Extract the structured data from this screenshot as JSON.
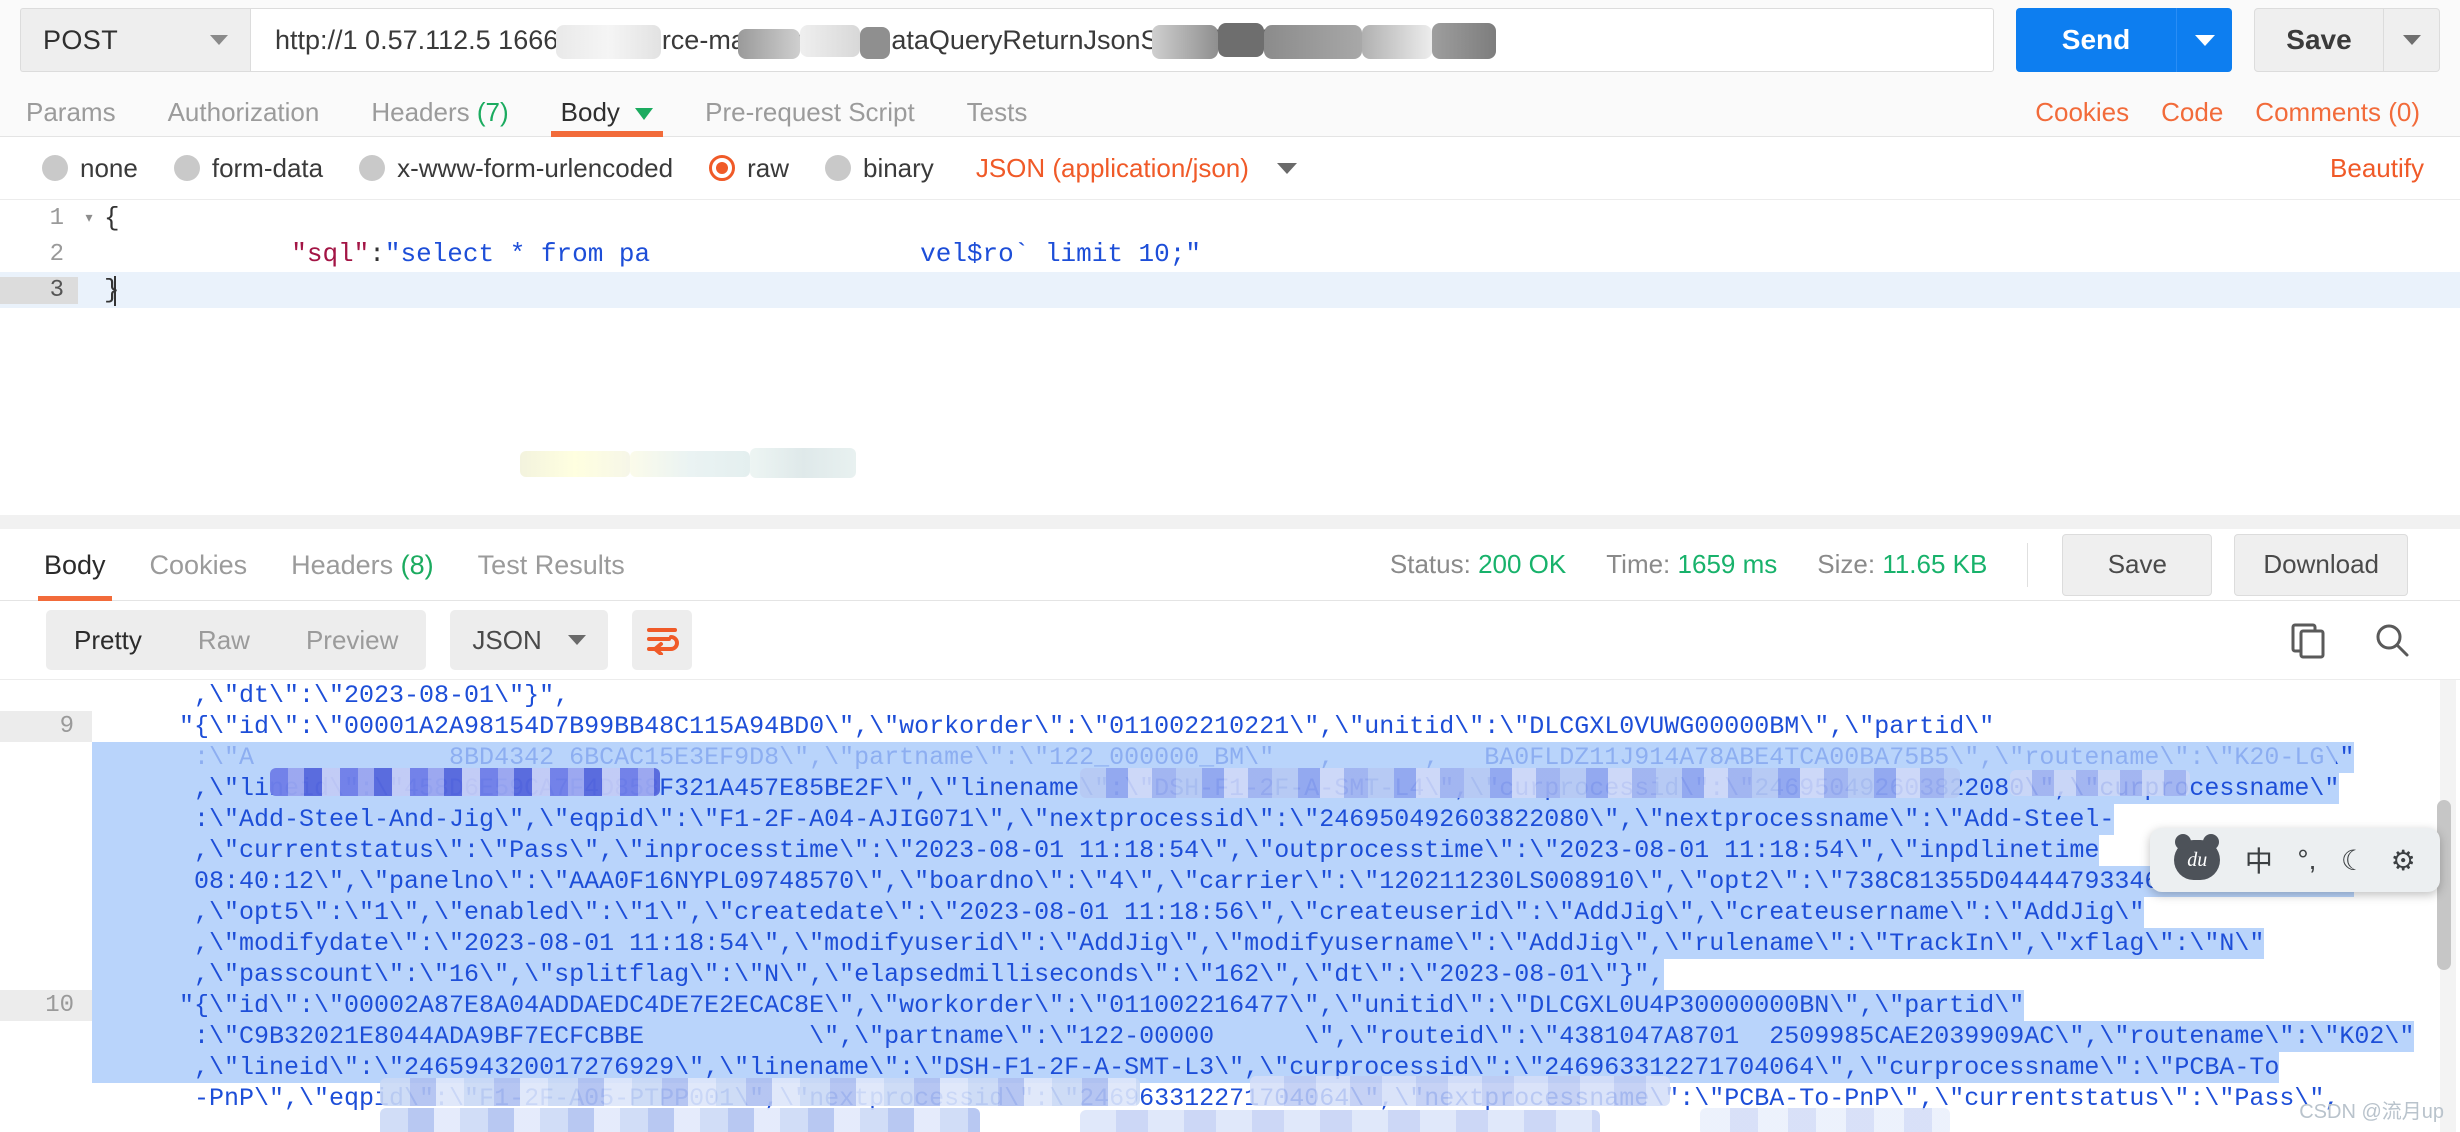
{
  "request": {
    "method": "POST",
    "url": "http://10.57.112.5:16666/add-resource-manager/smallDataQueryReturnJsonStrWithSqlDataJson",
    "url_visible": "http://1  0.57.112.5 16666/ad      source-manager/sm  lDataQueryReturnJsonStrWithSqlDataJson",
    "send_label": "Send",
    "save_label": "Save",
    "tabs": [
      {
        "label": "Params",
        "active": false,
        "count": ""
      },
      {
        "label": "Authorization",
        "active": false,
        "count": ""
      },
      {
        "label": "Headers",
        "active": false,
        "count": "(7)"
      },
      {
        "label": "Body",
        "active": true,
        "count": ""
      },
      {
        "label": "Pre-request Script",
        "active": false,
        "count": ""
      },
      {
        "label": "Tests",
        "active": false,
        "count": ""
      }
    ],
    "links": [
      "Cookies",
      "Code",
      "Comments (0)"
    ]
  },
  "body_types": [
    {
      "label": "none",
      "checked": false
    },
    {
      "label": "form-data",
      "checked": false
    },
    {
      "label": "x-www-form-urlencoded",
      "checked": false
    },
    {
      "label": "raw",
      "checked": true
    },
    {
      "label": "binary",
      "checked": false
    }
  ],
  "body_format": "JSON (application/json)",
  "beautify_label": "Beautify",
  "editor": {
    "lines": [
      {
        "num": "1",
        "fold": "▾",
        "text": "{",
        "current": false
      },
      {
        "num": "2",
        "fold": "",
        "text": "    \"sql\":\"select * from pa                       vel$ro` limit 10;\"",
        "current": false
      },
      {
        "num": "3",
        "fold": "",
        "text": "}",
        "current": true
      }
    ],
    "line2_key": "\"sql\"",
    "line2_sep": ":",
    "line2_val_start": "\"select * from pa",
    "line2_val_end": "vel$ro` limit 10;\""
  },
  "response": {
    "tabs": [
      {
        "label": "Body",
        "active": true,
        "count": ""
      },
      {
        "label": "Cookies",
        "active": false,
        "count": ""
      },
      {
        "label": "Headers",
        "active": false,
        "count": "(8)"
      },
      {
        "label": "Test Results",
        "active": false,
        "count": ""
      }
    ],
    "status_label": "Status:",
    "status_value": "200 OK",
    "time_label": "Time:",
    "time_value": "1659 ms",
    "size_label": "Size:",
    "size_value": "11.65 KB",
    "save_label": "Save",
    "download_label": "Download",
    "view_modes": [
      {
        "label": "Pretty",
        "active": true
      },
      {
        "label": "Raw",
        "active": false
      },
      {
        "label": "Preview",
        "active": false
      }
    ],
    "format": "JSON",
    "wrap_icon": "word-wrap-icon",
    "copy_icon": "copy-icon",
    "search_icon": "search-icon",
    "body_lines": [
      {
        "num": "",
        "sel": false,
        "text": "      ,\\\"dt\\\":\\\"2023-08-01\\\"}\","
      },
      {
        "num": "9",
        "sel": false,
        "text": "     \"{\\\"id\\\":\\\"00001A2A98154D7B99BB48C115A94BD0\\\",\\\"workorder\\\":\\\"011002210221\\\",\\\"unitid\\\":\\\"DLCGXL0VUWG00000BM\\\",\\\"partid\\\""
      },
      {
        "num": "",
        "sel": true,
        "text": "      :\\\"A             8BD4342 6BCAC15E3EF9D8\\\",\\\"partname\\\":\\\"122_000000_BM\\\"   ,      ,   BA0FLDZ11J914A78ABE4TCA00BA75B5\\\",\\\"routename\\\":\\\"K20-LG\\\""
      },
      {
        "num": "",
        "sel": true,
        "text": "      ,\\\"lineid\\\":\\\"458D6E59CA7F4D858F321A457E85BE2F\\\",\\\"linename\\\":\\\"DSH-F1-2F-A-SMT-L4\\\",\\\"curprocessid\\\":\\\"246950492603822080\\\",\\\"curprocessname\\\""
      },
      {
        "num": "",
        "sel": true,
        "text": "      :\\\"Add-Steel-And-Jig\\\",\\\"eqpid\\\":\\\"F1-2F-A04-AJIG071\\\",\\\"nextprocessid\\\":\\\"246950492603822080\\\",\\\"nextprocessname\\\":\\\"Add-Steel-"
      },
      {
        "num": "",
        "sel": true,
        "text": "      ,\\\"currentstatus\\\":\\\"Pass\\\",\\\"inprocesstime\\\":\\\"2023-08-01 11:18:54\\\",\\\"outprocesstime\\\":\\\"2023-08-01 11:18:54\\\",\\\"inpdlinetime"
      },
      {
        "num": "",
        "sel": true,
        "text": "      08:40:12\\\",\\\"panelno\\\":\\\"AAA0F16NYPL09748570\\\",\\\"boardno\\\":\\\"4\\\",\\\"carrier\\\":\\\"120211230LS008910\\\",\\\"opt2\\\":\\\"738C81355D044447933465DF8D1D1292\\\""
      },
      {
        "num": "",
        "sel": true,
        "text": "      ,\\\"opt5\\\":\\\"1\\\",\\\"enabled\\\":\\\"1\\\",\\\"createdate\\\":\\\"2023-08-01 11:18:56\\\",\\\"createuserid\\\":\\\"AddJig\\\",\\\"createusername\\\":\\\"AddJig\\\""
      },
      {
        "num": "",
        "sel": true,
        "text": "      ,\\\"modifydate\\\":\\\"2023-08-01 11:18:54\\\",\\\"modifyuserid\\\":\\\"AddJig\\\",\\\"modifyusername\\\":\\\"AddJig\\\",\\\"rulename\\\":\\\"TrackIn\\\",\\\"xflag\\\":\\\"N\\\""
      },
      {
        "num": "",
        "sel": true,
        "text": "      ,\\\"passcount\\\":\\\"16\\\",\\\"splitflag\\\":\\\"N\\\",\\\"elapsedmilliseconds\\\":\\\"162\\\",\\\"dt\\\":\\\"2023-08-01\\\"}\","
      },
      {
        "num": "10",
        "sel": true,
        "text": "     \"{\\\"id\\\":\\\"00002A87E8A04ADDAEDC4DE7E2ECAC8E\\\",\\\"workorder\\\":\\\"011002216477\\\",\\\"unitid\\\":\\\"DLCGXL0U4P30000000BN\\\",\\\"partid\\\""
      },
      {
        "num": "",
        "sel": true,
        "text": "      :\\\"C9B32021E8044ADA9BF7ECFCBBE           \\\",\\\"partname\\\":\\\"122-00000      \\\",\\\"routeid\\\":\\\"4381047A8701  2509985CAE2039909AC\\\",\\\"routename\\\":\\\"K02\\\""
      },
      {
        "num": "",
        "sel": true,
        "text": "      ,\\\"lineid\\\":\\\"246594320017276929\\\",\\\"linename\\\":\\\"DSH-F1-2F-A-SMT-L3\\\",\\\"curprocessid\\\":\\\"246963312271704064\\\",\\\"curprocessname\\\":\\\"PCBA-To"
      },
      {
        "num": "",
        "sel": false,
        "text": "      -PnP\\\",\\\"eqpid\\\":\\\"F1-2F-A05-PTPP001\\\",\\\"nextprocessid\\\":\\\"246963312271704064\\\",\\\"nextprocessname\\\":\\\"PCBA-To-PnP\\\",\\\"currentstatus\\\":\\\"Pass\\\","
      }
    ]
  },
  "ime_bar": {
    "logo": "baidu-ime-logo",
    "items": [
      {
        "icon": "chinese-mode-icon",
        "glyph": "中"
      },
      {
        "icon": "punctuation-icon",
        "glyph": "°,"
      },
      {
        "icon": "moon-icon",
        "glyph": "☾"
      },
      {
        "icon": "gear-icon",
        "glyph": "⚙"
      }
    ]
  },
  "watermark": "CSDN @流月up",
  "colors": {
    "accent_orange": "#f26b3a",
    "send_blue": "#0d7ef0",
    "status_green": "#18b26b",
    "json_blue": "#1d4ed8",
    "selection_blue": "#b9d4fb"
  }
}
